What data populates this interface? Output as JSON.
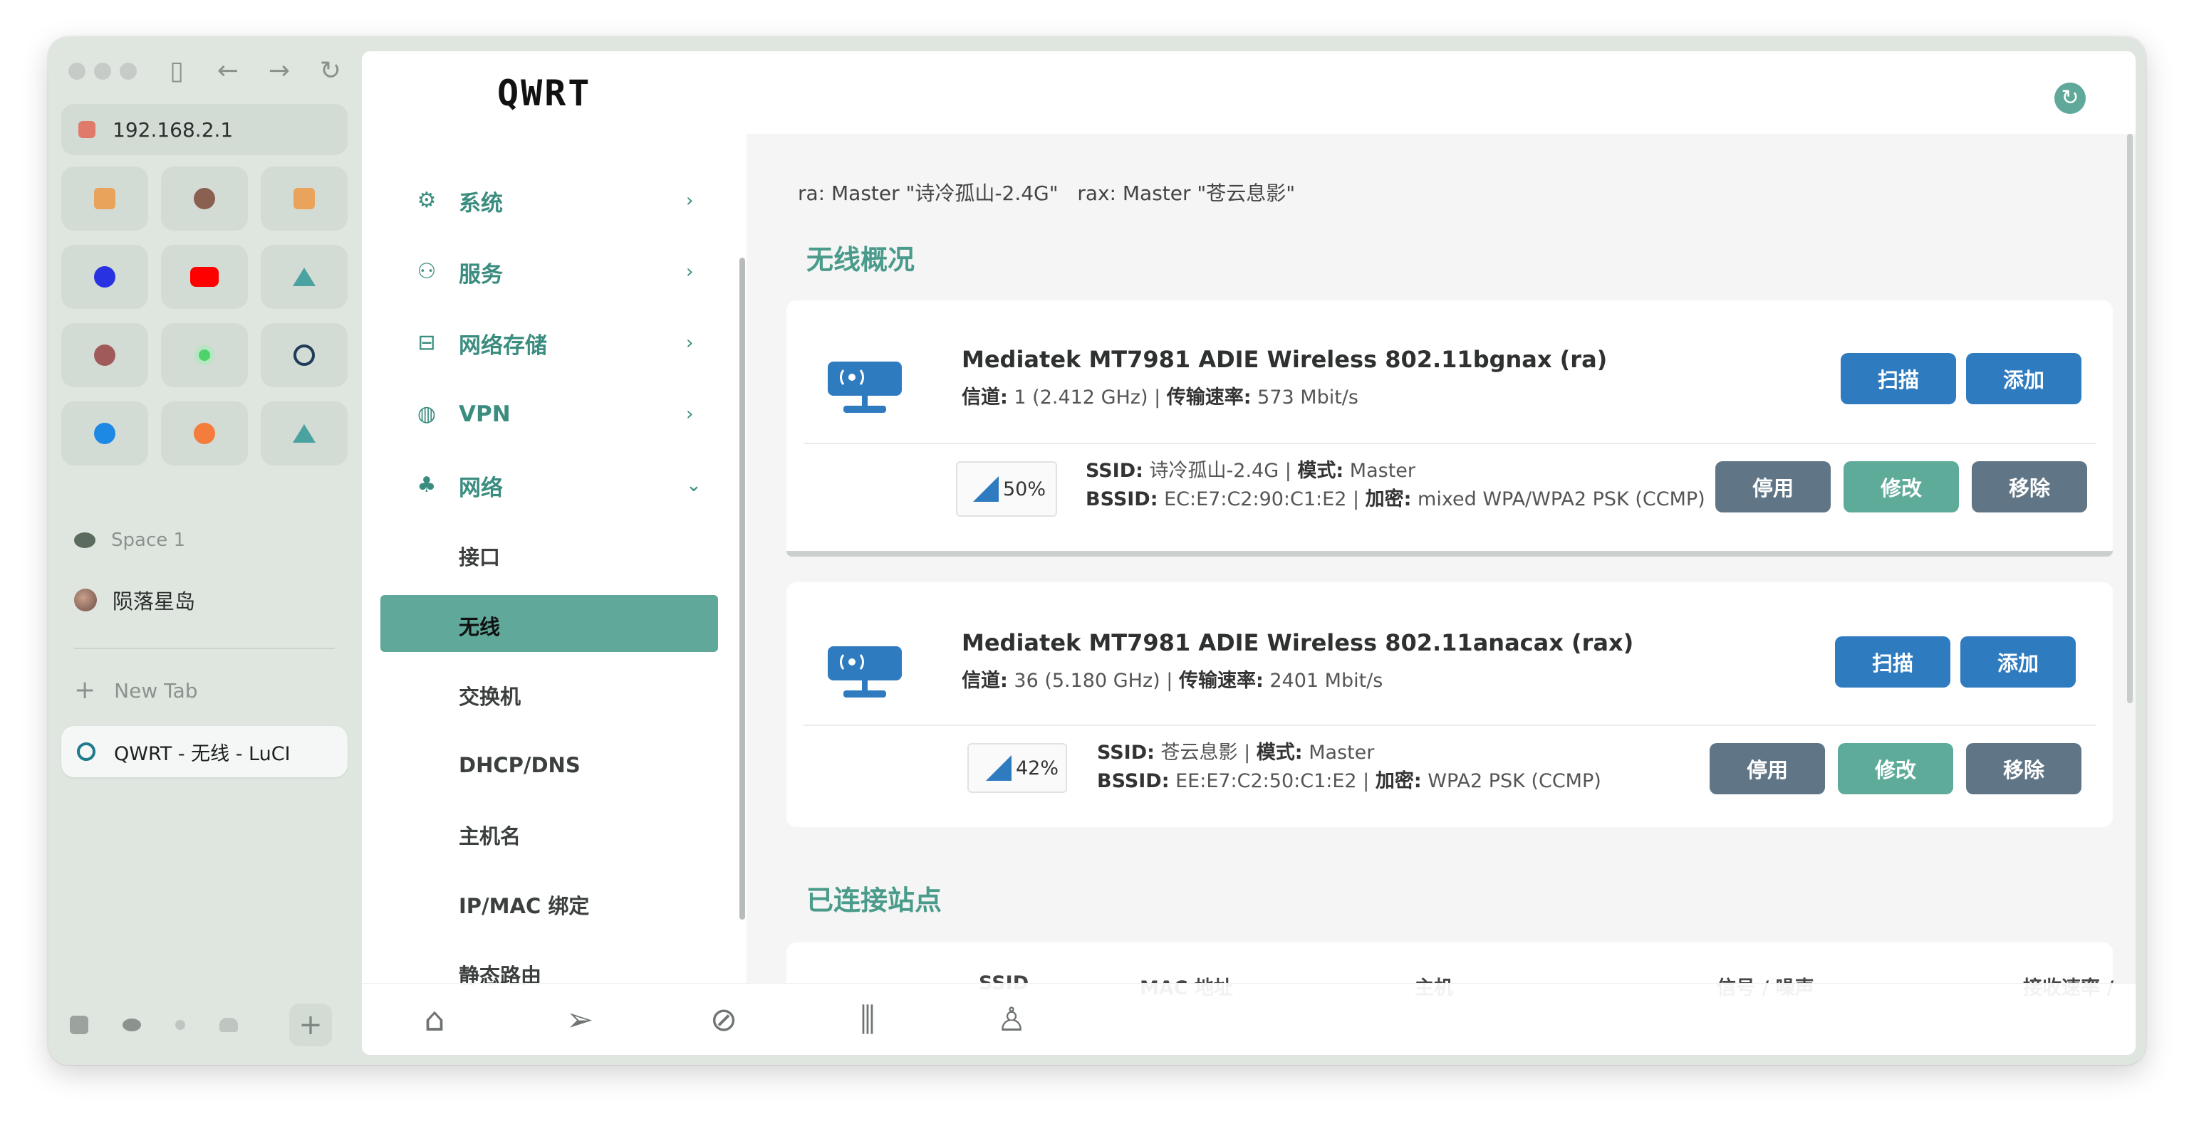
{
  "browser": {
    "url": "192.168.2.1",
    "space_label": "Space 1",
    "pinned_tab_label": "陨落星岛",
    "new_tab_label": "New Tab",
    "active_tab_title": "QWRT - 无线 - LuCI",
    "nav_icons": [
      "sidebar-toggle-icon",
      "back-icon",
      "forward-icon",
      "reload-icon"
    ],
    "favorites": [
      {
        "icon": "app-icon",
        "color": "#e9a35a"
      },
      {
        "icon": "avatar-icon",
        "color": "#8a6050"
      },
      {
        "icon": "app-icon",
        "color": "#e9a35a"
      },
      {
        "icon": "baidu-icon",
        "color": "#2932e1"
      },
      {
        "icon": "youtube-icon",
        "color": "#ff0000"
      },
      {
        "icon": "triangle-icon",
        "color": "#4aa3a0"
      },
      {
        "icon": "avatar-icon",
        "color": "#a05a5a"
      },
      {
        "icon": "dot-icon",
        "color": "#4cd36a"
      },
      {
        "icon": "openwrt-icon",
        "color": "#1f3b57"
      },
      {
        "icon": "moon-icon",
        "color": "#1e88e5"
      },
      {
        "icon": "fruit-icon",
        "color": "#f47c3c"
      },
      {
        "icon": "triangle-icon",
        "color": "#4aa3a0"
      }
    ]
  },
  "app": {
    "brand": "QWRT",
    "accent": "#5fa89a"
  },
  "menu": {
    "items": [
      {
        "label": "系统",
        "icon": "gear-icon",
        "glyph": "⚙",
        "chevron": "›"
      },
      {
        "label": "服务",
        "icon": "user-service-icon",
        "glyph": "⚇",
        "chevron": "›"
      },
      {
        "label": "网络存储",
        "icon": "storage-icon",
        "glyph": "⊟",
        "chevron": "›"
      },
      {
        "label": "VPN",
        "icon": "globe-icon",
        "glyph": "◍",
        "chevron": "›"
      },
      {
        "label": "网络",
        "icon": "network-icon",
        "glyph": "♣",
        "chevron": "⌄"
      }
    ],
    "network_sub": [
      "接口",
      "无线",
      "交换机",
      "DHCP/DNS",
      "主机名",
      "IP/MAC 绑定",
      "静态路由"
    ]
  },
  "main": {
    "info_line": "ra: Master \"诗冷孤山-2.4G\"   rax: Master \"苍云息影\"",
    "wireless_title": "无线概况",
    "connected_title": "已连接站点",
    "radios": [
      {
        "title": "Mediatek MT7981 ADIE Wireless 802.11bgnax (ra)",
        "channel_label": "信道:",
        "channel_value": " 1 (2.412 GHz) | ",
        "rate_label": "传输速率:",
        "rate_value": " 573 Mbit/s",
        "scan": "扫描",
        "add": "添加",
        "signal": "50%",
        "ssid_label": "SSID:",
        "ssid_value": " 诗冷孤山-2.4G | ",
        "mode_label": "模式:",
        "mode_value": " Master",
        "bssid_label": "BSSID:",
        "bssid_value": " EC:E7:C2:90:C1:E2 | ",
        "enc_label": "加密:",
        "enc_value": " mixed WPA/WPA2 PSK (CCMP)",
        "disable": "停用",
        "edit": "修改",
        "remove": "移除"
      },
      {
        "title": "Mediatek MT7981 ADIE Wireless 802.11anacax (rax)",
        "channel_label": "信道:",
        "channel_value": " 36 (5.180 GHz) | ",
        "rate_label": "传输速率:",
        "rate_value": " 2401 Mbit/s",
        "scan": "扫描",
        "add": "添加",
        "signal": "42%",
        "ssid_label": "SSID:",
        "ssid_value": " 苍云息影 | ",
        "mode_label": "模式:",
        "mode_value": " Master",
        "bssid_label": "BSSID:",
        "bssid_value": " EE:E7:C2:50:C1:E2 | ",
        "enc_label": "加密:",
        "enc_value": " WPA2 PSK (CCMP)",
        "disable": "停用",
        "edit": "修改",
        "remove": "移除"
      }
    ],
    "table_headers": [
      "SSID",
      "MAC 地址",
      "主机",
      "信号 / 噪声",
      "接收速率 /"
    ]
  },
  "bottom_nav": [
    {
      "icon": "home-icon",
      "glyph": "⌂"
    },
    {
      "icon": "send-icon",
      "glyph": "➢"
    },
    {
      "icon": "compass-icon",
      "glyph": "⊘"
    },
    {
      "icon": "bar-chart-icon",
      "glyph": "⫼"
    },
    {
      "icon": "user-icon",
      "glyph": "♙"
    }
  ]
}
